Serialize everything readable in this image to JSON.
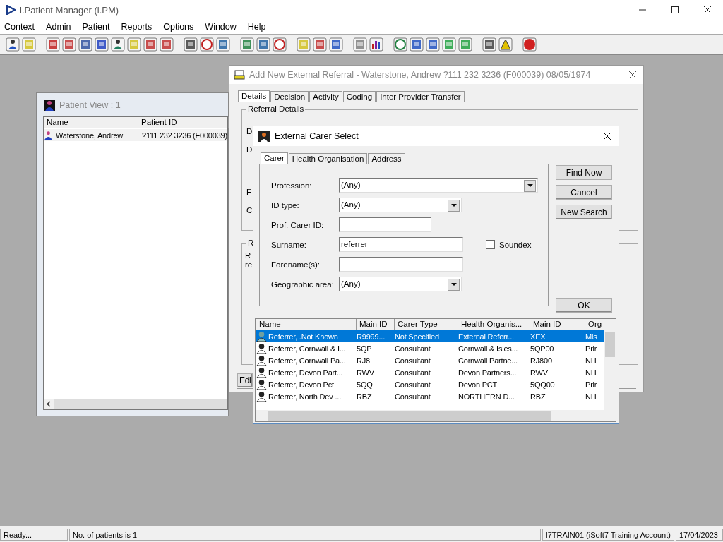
{
  "app": {
    "title": "i.Patient Manager (i.PM)",
    "menu": [
      "Context",
      "Admin",
      "Patient",
      "Reports",
      "Options",
      "Window",
      "Help"
    ]
  },
  "patient_view": {
    "title": "Patient View : 1",
    "columns": [
      "Name",
      "Patient ID"
    ],
    "rows": [
      {
        "name": "Waterstone, Andrew",
        "patient_id": "?111 232 3236 (F000039)",
        "selected": false
      }
    ]
  },
  "referral_window": {
    "title": "Add New External Referral - Waterstone, Andrew ?111 232 3236 (F000039) 08/05/1974",
    "tabs": [
      {
        "label": "Details",
        "selected": true
      },
      {
        "label": "Decision",
        "selected": false
      },
      {
        "label": "Activity",
        "selected": false
      },
      {
        "label": "Coding",
        "selected": false
      },
      {
        "label": "Inter Provider Transfer",
        "selected": false
      }
    ],
    "group_label": "Referral Details",
    "label_fragments": [
      "D",
      "D",
      "F",
      "C"
    ],
    "second_group_label": "R",
    "text_fragments": [
      "R",
      "re"
    ],
    "button_fragment": "Edi"
  },
  "carer_dialog": {
    "title": "External Carer Select",
    "tabs": [
      {
        "label": "Carer",
        "selected": true
      },
      {
        "label": "Health Organisation",
        "selected": false
      },
      {
        "label": "Address",
        "selected": false
      }
    ],
    "fields": [
      {
        "kind": "combo",
        "label": "Profession:",
        "value": "(Any)"
      },
      {
        "kind": "combo",
        "label": "ID type:",
        "value": "(Any)"
      },
      {
        "kind": "text",
        "label": "Prof. Carer ID:"
      },
      {
        "kind": "text",
        "label": "Surname:",
        "value": "referrer"
      },
      {
        "kind": "text",
        "label": "Forename(s):"
      },
      {
        "kind": "combo",
        "label": "Geographic area:",
        "value": "(Any)"
      }
    ],
    "soundex": {
      "label": "Soundex",
      "checked": false
    },
    "buttons": [
      "Find Now",
      "Cancel",
      "New Search"
    ],
    "ok_button": "OK",
    "columns": [
      "Name",
      "Main ID",
      "Carer Type",
      "Health Organis...",
      "Main ID",
      "Org"
    ],
    "rows": [
      {
        "cells": [
          "Referrer, .Not Known",
          "R9999...",
          "Not Specified",
          "External Referr...",
          "XEX",
          "Mis"
        ],
        "selected": true
      },
      {
        "cells": [
          "Referrer, Cornwall & I...",
          "5QP",
          "Consultant",
          "Cornwall & Isles...",
          "5QP00",
          "Prir"
        ],
        "selected": false
      },
      {
        "cells": [
          "Referrer, Cornwall Pa...",
          "RJ8",
          "Consultant",
          "Cornwall Partne...",
          "RJ800",
          "NH"
        ],
        "selected": false
      },
      {
        "cells": [
          "Referrer, Devon Part...",
          "RWV",
          "Consultant",
          "Devon Partners...",
          "RWV",
          "NH"
        ],
        "selected": false
      },
      {
        "cells": [
          "Referrer, Devon Pct",
          "5QQ",
          "Consultant",
          "Devon PCT",
          "5QQ00",
          "Prir"
        ],
        "selected": false
      },
      {
        "cells": [
          "Referrer, North Dev ...",
          "RBZ",
          "Consultant",
          "NORTHERN D...",
          "RBZ",
          "NH"
        ],
        "selected": false
      }
    ]
  },
  "status_bar": [
    "Ready...",
    "No. of patients is 1",
    "I7TRAIN01 (iSoft7 Training Account)",
    "17/04/2023"
  ]
}
